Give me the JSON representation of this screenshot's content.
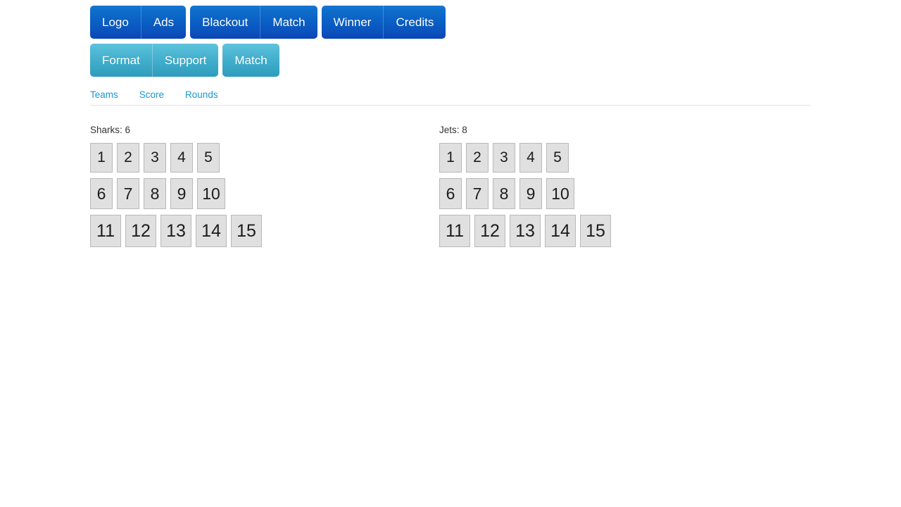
{
  "toolbar": {
    "row1": [
      {
        "group": 1,
        "buttons": [
          "Logo",
          "Ads"
        ]
      },
      {
        "group": 2,
        "buttons": [
          "Blackout",
          "Match"
        ]
      },
      {
        "group": 3,
        "buttons": [
          "Winner",
          "Credits"
        ]
      }
    ],
    "row2": [
      {
        "group": 1,
        "buttons": [
          "Format",
          "Support"
        ]
      },
      {
        "group": 2,
        "buttons": [
          "Match"
        ]
      }
    ],
    "colors": {
      "primary_top": "#1576d0",
      "primary_bottom": "#0a46b4",
      "info_top": "#5ec3dc",
      "info_bottom": "#2f9cbd",
      "button_text": "#ffffff"
    }
  },
  "tabs": {
    "items": [
      "Teams",
      "Score",
      "Rounds"
    ],
    "link_color": "#1a97d4",
    "divider_color": "#e2e2e2"
  },
  "board": {
    "cell_background": "#e0e0e0",
    "cell_border": "#b9b9b9",
    "columns": [
      {
        "label": "Sharks: 6",
        "team": "Sharks",
        "score": "6",
        "rows": [
          [
            "1",
            "2",
            "3",
            "4",
            "5"
          ],
          [
            "6",
            "7",
            "8",
            "9",
            "10"
          ],
          [
            "11",
            "12",
            "13",
            "14",
            "15"
          ]
        ]
      },
      {
        "label": "Jets: 8",
        "team": "Jets",
        "score": "8",
        "rows": [
          [
            "1",
            "2",
            "3",
            "4",
            "5"
          ],
          [
            "6",
            "7",
            "8",
            "9",
            "10"
          ],
          [
            "11",
            "12",
            "13",
            "14",
            "15"
          ]
        ]
      }
    ]
  }
}
